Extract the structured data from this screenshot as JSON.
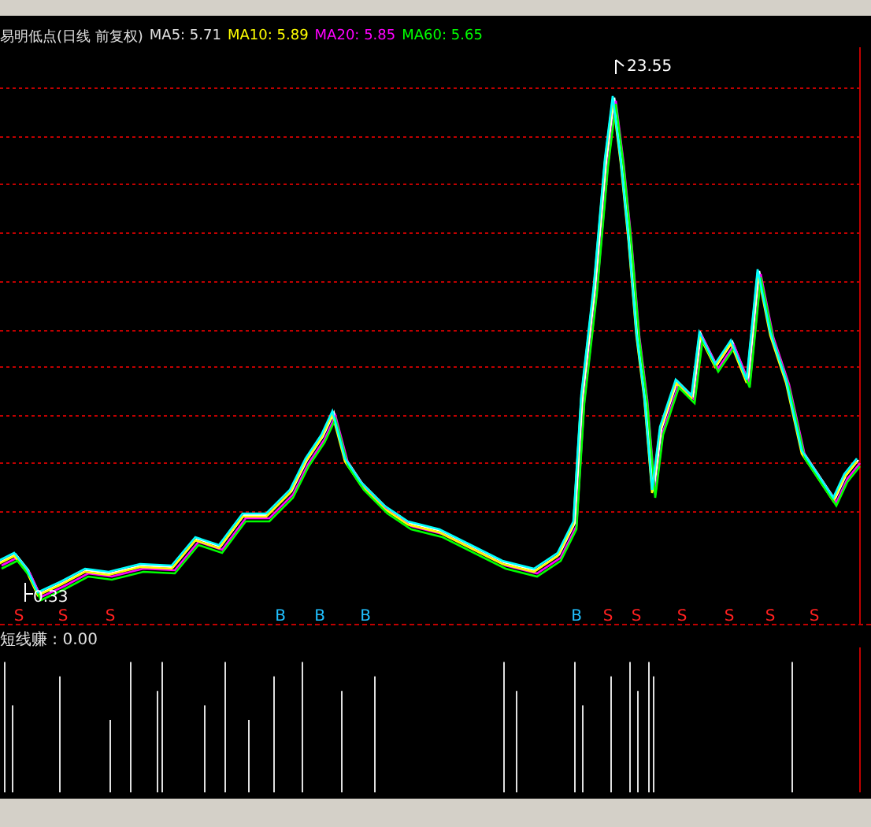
{
  "chart_title": "易明低点(日线 前复权)",
  "moving_averages": [
    {
      "label": "MA5: 5.71",
      "color": "#e0e0e0"
    },
    {
      "label": "MA10: 5.89",
      "color": "#ffff00"
    },
    {
      "label": "MA20: 5.85",
      "color": "#ff00ff"
    },
    {
      "label": "MA60: 5.65",
      "color": "#00ff00"
    }
  ],
  "price_labels": {
    "high": "23.55",
    "low": "0.33"
  },
  "signals": [
    {
      "kind": "sell",
      "label": "S"
    },
    {
      "kind": "sell",
      "label": "S"
    },
    {
      "kind": "sell",
      "label": "S"
    },
    {
      "kind": "buy",
      "label": "B"
    },
    {
      "kind": "buy",
      "label": "B"
    },
    {
      "kind": "buy",
      "label": "B"
    },
    {
      "kind": "buy",
      "label": "B"
    },
    {
      "kind": "sell",
      "label": "S"
    },
    {
      "kind": "sell",
      "label": "S"
    },
    {
      "kind": "sell",
      "label": "S"
    },
    {
      "kind": "sell",
      "label": "S"
    },
    {
      "kind": "sell",
      "label": "S"
    },
    {
      "kind": "sell",
      "label": "S"
    }
  ],
  "indicator": {
    "label": "短线赚 : 0.00"
  }
}
